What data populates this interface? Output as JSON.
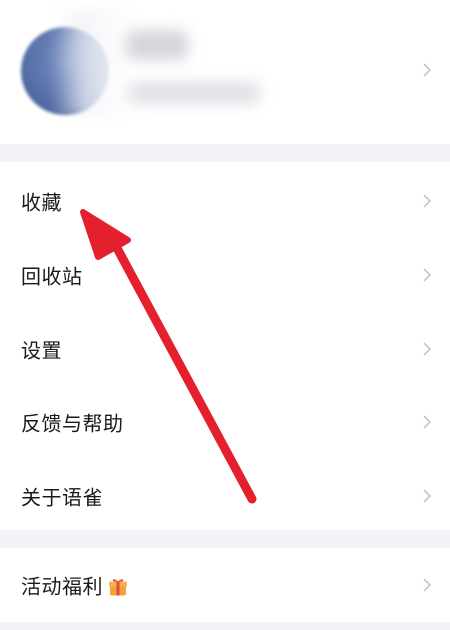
{
  "profile": {
    "chevron_icon": "chevron-right-icon"
  },
  "menu": {
    "items": [
      {
        "label": "收藏",
        "icon": "chevron-right-icon"
      },
      {
        "label": "回收站",
        "icon": "chevron-right-icon"
      },
      {
        "label": "设置",
        "icon": "chevron-right-icon"
      },
      {
        "label": "反馈与帮助",
        "icon": "chevron-right-icon"
      },
      {
        "label": "关于语雀",
        "icon": "chevron-right-icon"
      }
    ]
  },
  "promo": {
    "label": "活动福利",
    "badge_icon": "gift-icon",
    "icon": "chevron-right-icon"
  },
  "annotation": {
    "icon": "red-arrow-icon",
    "color": "#e4202f",
    "points_to": "收藏"
  },
  "colors": {
    "background": "#f2f3f7",
    "card": "#ffffff",
    "text": "#1a1a1a",
    "chevron": "#c5c7cc"
  }
}
